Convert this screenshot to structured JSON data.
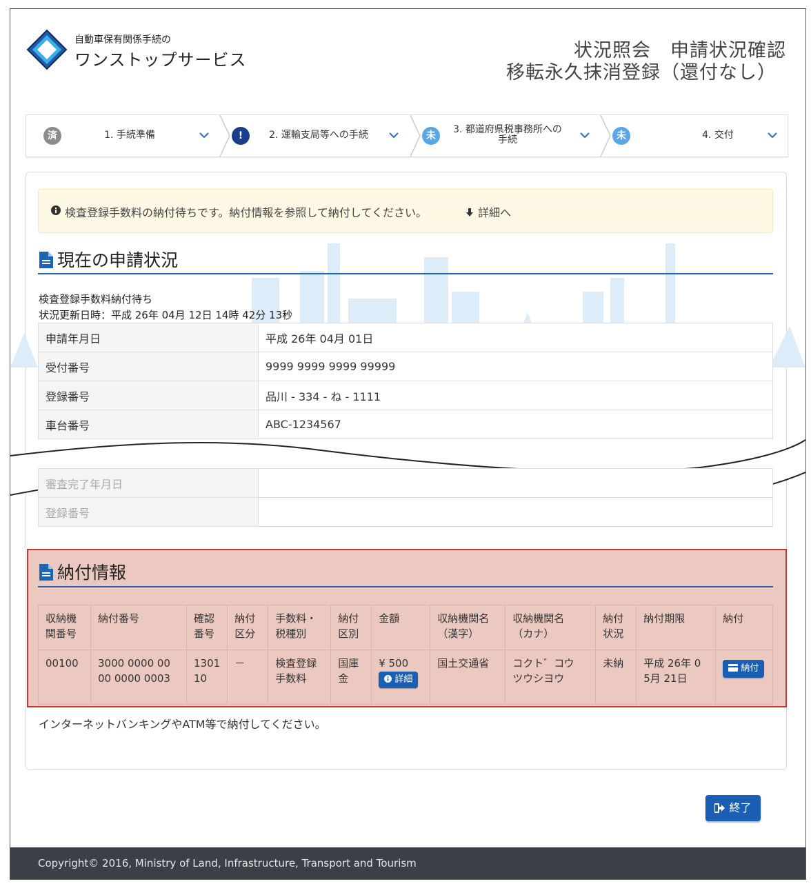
{
  "header": {
    "service_small": "自動車保有関係手続の",
    "service_big": "ワンストップサービス",
    "title_line1": "状況照会　申請状況確認",
    "title_line2": "移転永久抹消登録（還付なし）"
  },
  "steps": [
    {
      "badge": "済",
      "label": "1. 手続準備",
      "color": "#8c8c8c"
    },
    {
      "badge": "!",
      "label": "2. 運輸支局等への手続",
      "color": "#1a3e8c"
    },
    {
      "badge": "未",
      "label_line1": "3. 都道府県税事務所への",
      "label_line2": "手続",
      "color": "#5aa6e6"
    },
    {
      "badge": "未",
      "label": "4. 交付",
      "color": "#5aa6e6"
    }
  ],
  "alert": {
    "text": "検査登録手数料の納付待ちです。納付情報を参照して納付してください。",
    "link": "詳細へ"
  },
  "current": {
    "heading": "現在の申請状況",
    "status": "検査登録手数料納付待ち",
    "updated": "状況更新日時：平成 26年 04月 12日 14時 42分 13秒",
    "rows": [
      {
        "key": "申請年月日",
        "value": "平成 26年 04月 01日"
      },
      {
        "key": "受付番号",
        "value": "9999 9999 9999 99999"
      },
      {
        "key": "登録番号",
        "value": "品川 - 334 - ね - 1111"
      },
      {
        "key": "車台番号",
        "value": "ABC-1234567"
      }
    ],
    "rows_after_break": [
      {
        "key": "審査完了年月日",
        "value": ""
      },
      {
        "key": "登録番号",
        "value": ""
      }
    ]
  },
  "payment": {
    "heading": "納付情報",
    "headers": [
      [
        "収納機",
        "関番号"
      ],
      [
        "納付番号"
      ],
      [
        "確認",
        "番号"
      ],
      [
        "納付",
        "区分"
      ],
      [
        "手数料・",
        "税種別"
      ],
      [
        "納付",
        "区別"
      ],
      [
        "金額"
      ],
      [
        "収納機関名",
        "（漢字）"
      ],
      [
        "収納機関名",
        "（カナ）"
      ],
      [
        "納付",
        "状況"
      ],
      [
        "納付期限"
      ],
      [
        "納付"
      ]
    ],
    "row": {
      "agency_no": "00100",
      "pay_no_1": "3000 0000 00",
      "pay_no_2": "00 0000 0003",
      "confirm_1": "1301",
      "confirm_2": "10",
      "division": "－",
      "fee_type_1": "検査登録",
      "fee_type_2": "手数料",
      "pay_kind_1": "国庫",
      "pay_kind_2": "金",
      "amount": "¥ 500",
      "detail_label": "詳細",
      "agency_kanji": "国土交通省",
      "agency_kana_1": "コクト゛コウ",
      "agency_kana_2": "ツウシヨウ",
      "state": "未納",
      "deadline_1": "平成 26年 0",
      "deadline_2": "5月 21日",
      "pay_label": "納付"
    },
    "note": "インターネットバンキングやATM等で納付してください。"
  },
  "exit_label": "終了",
  "footer": "Copyright© 2016, Ministry of Land, Infrastructure, Transport and Tourism"
}
